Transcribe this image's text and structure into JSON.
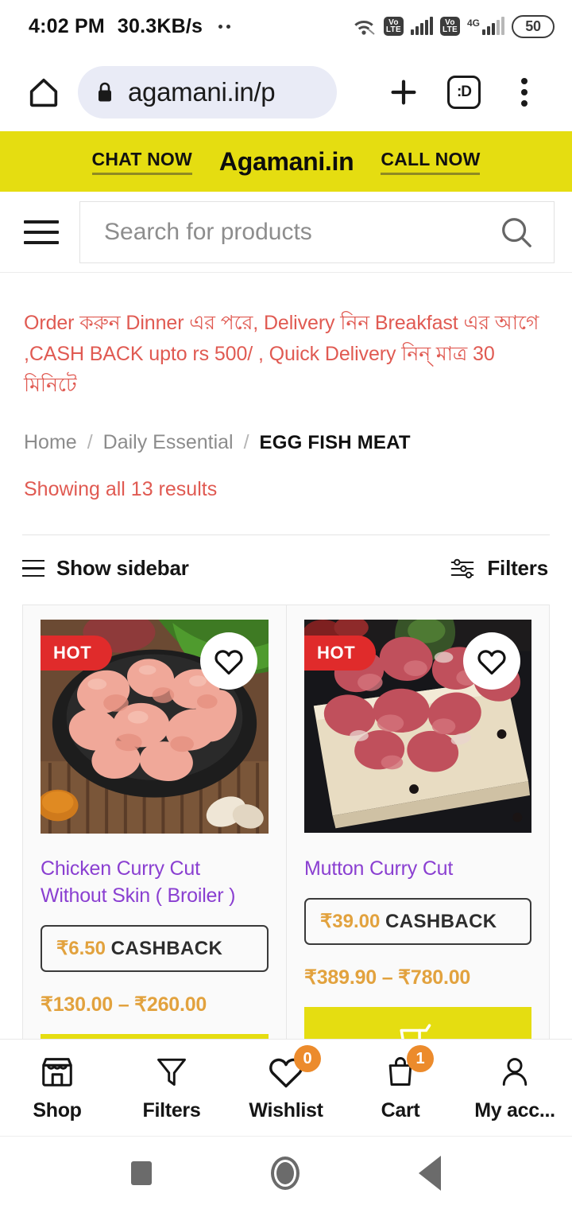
{
  "status_bar": {
    "time": "4:02 PM",
    "network_speed": "30.3KB/s",
    "volte_label": "Vo\nLTE",
    "volte_top": "Vo",
    "volte_bottom": "LTE",
    "network_type": "4G",
    "battery_level": "50"
  },
  "browser": {
    "url": "agamani.in/p",
    "home_icon": "home-icon",
    "lock_icon": "lock-icon",
    "new_tab_icon": "plus-icon",
    "tab_count_label": ":D",
    "menu_icon": "kebab-menu-icon"
  },
  "site_header": {
    "chat_now": "CHAT NOW",
    "brand": "Agamani.in",
    "call_now": "CALL NOW",
    "banner_color": "#e5dd11"
  },
  "search": {
    "placeholder": "Search for products",
    "menu_icon": "hamburger-icon",
    "search_icon": "search-icon"
  },
  "promo": {
    "text": "Order করুন Dinner এর পরে, Delivery নিন Breakfast এর আগে ,CASH BACK upto rs 500/ , Quick Delivery নিন্ মাত্র 30 মিনিটে",
    "color": "#e05a52"
  },
  "breadcrumb": {
    "items": [
      {
        "label": "Home",
        "current": false
      },
      {
        "label": "Daily Essential",
        "current": false
      },
      {
        "label": "EGG FISH MEAT",
        "current": true
      }
    ],
    "separator": "/"
  },
  "results": {
    "showing_text": "Showing all 13 results"
  },
  "toolbar": {
    "show_sidebar": "Show sidebar",
    "filters": "Filters"
  },
  "products": [
    {
      "title": "Chicken Curry Cut Without Skin ( Broiler )",
      "badge": "HOT",
      "cashback_amount": "₹6.50",
      "cashback_label": "CASHBACK",
      "price_range": "₹130.00 – ₹260.00",
      "wishlist_icon": "heart-icon",
      "cart_icon": "cart-icon",
      "image_alt": "chicken-curry-cut-image"
    },
    {
      "title": "Mutton Curry Cut",
      "badge": "HOT",
      "cashback_amount": "₹39.00",
      "cashback_label": "CASHBACK",
      "price_range": "₹389.90 – ₹780.00",
      "wishlist_icon": "heart-icon",
      "cart_icon": "cart-icon",
      "image_alt": "mutton-curry-cut-image"
    }
  ],
  "bottom_nav": [
    {
      "label": "Shop",
      "icon": "shop-icon",
      "badge": null
    },
    {
      "label": "Filters",
      "icon": "funnel-icon",
      "badge": null
    },
    {
      "label": "Wishlist",
      "icon": "heart-icon",
      "badge": "0"
    },
    {
      "label": "Cart",
      "icon": "bag-icon",
      "badge": "1"
    },
    {
      "label": "My acc...",
      "icon": "person-icon",
      "badge": null
    }
  ],
  "android_nav": {
    "recents": "recents-button",
    "home": "home-button",
    "back": "back-button"
  },
  "colors": {
    "accent_yellow": "#e5dd11",
    "price_orange": "#e2a23e",
    "title_purple": "#8a3fd1",
    "promo_red": "#e05a52",
    "badge_red": "#e02b2b",
    "badge_orange": "#ec8b2c"
  }
}
